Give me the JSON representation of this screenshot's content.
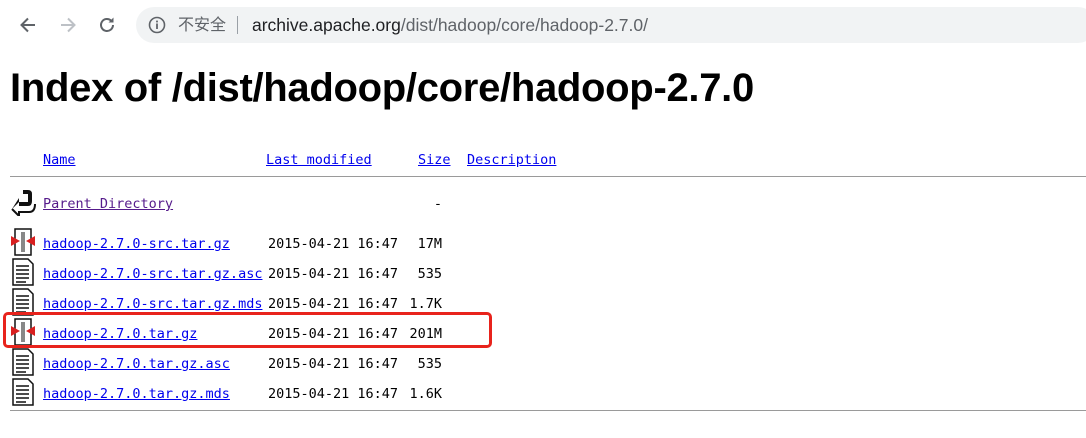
{
  "browser": {
    "security_label": "不安全",
    "url_host": "archive.apache.org",
    "url_path": "/dist/hadoop/core/hadoop-2.7.0/"
  },
  "page": {
    "title": "Index of /dist/hadoop/core/hadoop-2.7.0",
    "columns": {
      "name": "Name",
      "last_modified": "Last modified",
      "size": "Size",
      "description": "Description"
    },
    "parent": {
      "label": "Parent Directory",
      "size": "-",
      "icon": "back-arrow-icon"
    },
    "rows": [
      {
        "name": "hadoop-2.7.0-src.tar.gz",
        "date": "2015-04-21 16:47",
        "size": "17M",
        "icon": "archive-icon"
      },
      {
        "name": "hadoop-2.7.0-src.tar.gz.asc",
        "date": "2015-04-21 16:47",
        "size": "535",
        "icon": "text-file-icon"
      },
      {
        "name": "hadoop-2.7.0-src.tar.gz.mds",
        "date": "2015-04-21 16:47",
        "size": "1.7K",
        "icon": "text-file-icon"
      },
      {
        "name": "hadoop-2.7.0.tar.gz",
        "date": "2015-04-21 16:47",
        "size": "201M",
        "icon": "archive-icon"
      },
      {
        "name": "hadoop-2.7.0.tar.gz.asc",
        "date": "2015-04-21 16:47",
        "size": "535",
        "icon": "text-file-icon"
      },
      {
        "name": "hadoop-2.7.0.tar.gz.mds",
        "date": "2015-04-21 16:47",
        "size": "1.6K",
        "icon": "text-file-icon"
      }
    ]
  },
  "colors": {
    "link": "#0000ee",
    "visited_link": "#551a8b",
    "highlight": "#e8231c"
  }
}
